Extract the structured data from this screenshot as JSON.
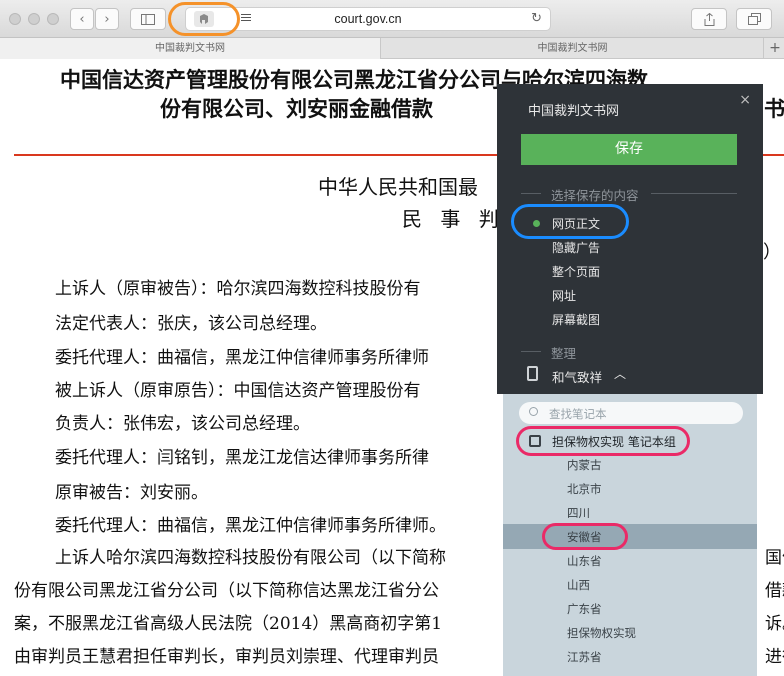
{
  "browser": {
    "url": "court.gov.cn",
    "extension_icon": "evernote-elephant-icon",
    "tabs": [
      {
        "label": "中国裁判文书网"
      },
      {
        "label": "中国裁判文书网"
      }
    ],
    "new_tab_label": "+",
    "nav_back": "‹",
    "nav_forward": "›"
  },
  "document": {
    "title_line1": "中国信达资产管理股份有限公司黑龙江省分公司与哈尔滨四海数",
    "title_line2": "份有限公司、刘安丽金融借款",
    "title_line2_right": "书",
    "court": "中华人民共和国最",
    "doc_type": "民 事 判 决",
    "case_no_fragment": "）",
    "paragraphs": [
      "上诉人（原审被告）：哈尔滨四海数控科技股份有",
      "法定代表人：张庆，该公司总经理。",
      "委托代理人：曲福信，黑龙江仲信律师事务所律师",
      "被上诉人（原审原告）：中国信达资产管理股份有",
      "负责人：张伟宏，该公司总经理。",
      "委托代理人：闫铭钊，黑龙江龙信达律师事务所律",
      "原审被告：刘安丽。",
      "委托代理人：曲福信，黑龙江仲信律师事务所律师。",
      "上诉人哈尔滨四海数控科技股份有限公司（以下简称"
    ],
    "body_lines": [
      "份有限公司黑龙江省分公司（以下简称信达黑龙江省分公",
      "案，不服黑龙江省高级人民法院（2014）黑高商初字第1",
      "由审判员王慧君担任审判长，审判员刘崇理、代理审判员"
    ],
    "right_edge": [
      "国信",
      "借款",
      "诉。",
      "进行"
    ]
  },
  "clipper": {
    "brand": "中国裁判文书网",
    "close": "×",
    "save_label": "保存",
    "content_section": "选择保存的内容",
    "options": [
      "网页正文",
      "隐藏广告",
      "整个页面",
      "网址",
      "屏幕截图"
    ],
    "selected_option": "网页正文",
    "organize_section": "整理",
    "notebook": "和气致祥",
    "search_placeholder": "查找笔记本",
    "stack": "担保物权实现 笔记本组",
    "notebooks": [
      "内蒙古",
      "北京市",
      "四川",
      "安徽省",
      "山东省",
      "山西",
      "广东省",
      "担保物权实现",
      "江苏省"
    ],
    "highlighted_notebook": "安徽省"
  },
  "annotations": {
    "orange": "#f5922a",
    "blue": "#1a8cff",
    "pink": "#ea2a67"
  },
  "colors": {
    "save_green": "#59b25a",
    "panel_dark": "#2e3338",
    "list_bg": "#c9d5dc",
    "rule_red": "#d9381e"
  }
}
